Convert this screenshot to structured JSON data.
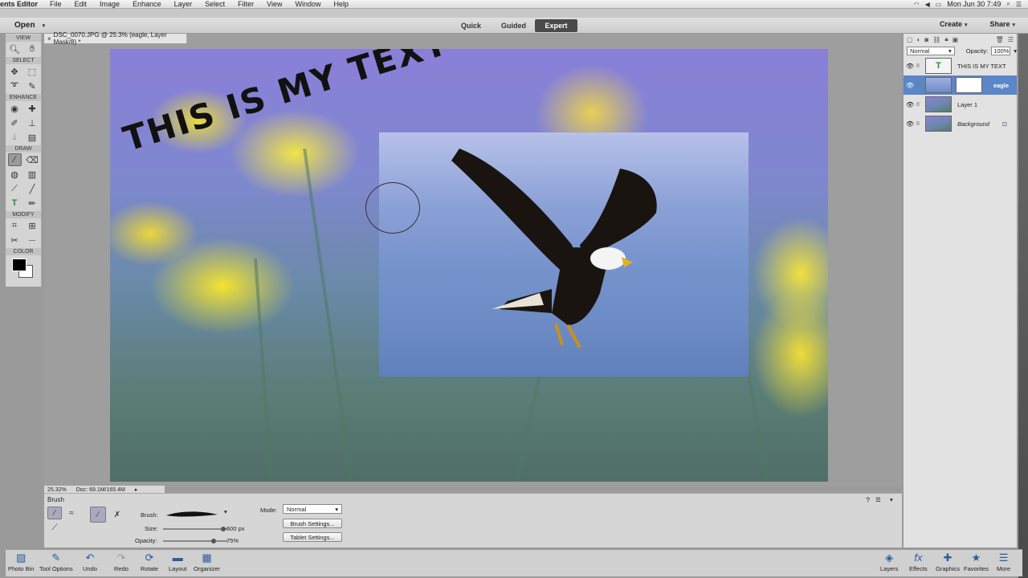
{
  "menubar": {
    "app": "ents Editor",
    "items": [
      "File",
      "Edit",
      "Image",
      "Enhance",
      "Layer",
      "Select",
      "Filter",
      "View",
      "Window",
      "Help"
    ],
    "clock": "Mon Jun 30  7:49"
  },
  "appbar": {
    "open": "Open",
    "modes": [
      "Quick",
      "Guided",
      "Expert"
    ],
    "active_mode": "Expert",
    "create": "Create",
    "share": "Share"
  },
  "document": {
    "tab": "DSC_0070.JPG @ 25.3% (eagle, Layer Mask/8) *",
    "canvas_text": "THIS IS MY TEXT",
    "zoom": "25.32%",
    "doc_size": "Doc: 69.1M/165.4M"
  },
  "toolbox": {
    "sections": [
      "VIEW",
      "SELECT",
      "ENHANCE",
      "DRAW",
      "MODIFY",
      "COLOR"
    ]
  },
  "tool_options": {
    "title": "Brush",
    "brush_label": "Brush:",
    "size_label": "Size:",
    "size_value": "600 px",
    "size_fraction": 0.9,
    "opacity_label": "Opacity:",
    "opacity_value": "75%",
    "opacity_fraction": 0.75,
    "mode_label": "Mode:",
    "mode_value": "Normal",
    "brush_settings": "Brush Settings...",
    "tablet_settings": "Tablet Settings..."
  },
  "layers": {
    "blend_mode": "Normal",
    "opacity_label": "Opacity:",
    "opacity_value": "100%",
    "items": [
      {
        "name": "THIS IS MY TEXT",
        "type": "text"
      },
      {
        "name": "eagle",
        "type": "image-mask",
        "selected": true
      },
      {
        "name": "Layer 1",
        "type": "image"
      },
      {
        "name": "Background",
        "type": "image"
      }
    ]
  },
  "bottombar": {
    "left": [
      "Photo Bin",
      "Tool Options",
      "Undo",
      "Redo",
      "Rotate",
      "Layout",
      "Organizer"
    ],
    "right": [
      "Layers",
      "Effects",
      "Graphics",
      "Favorites",
      "More"
    ]
  },
  "colors": {
    "selected_layer": "#5b86c7",
    "accent_icon": "#2c5d9a"
  }
}
